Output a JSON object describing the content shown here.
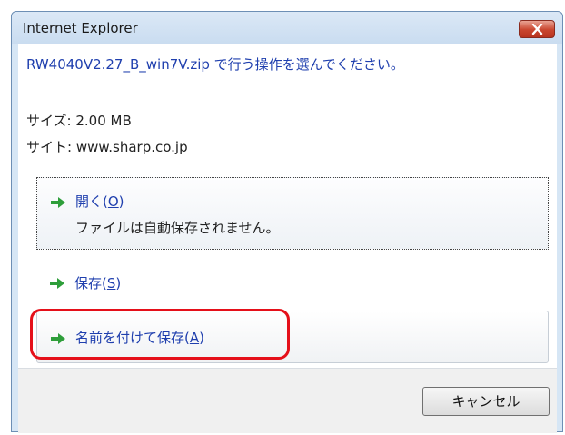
{
  "window": {
    "title": "Internet Explorer"
  },
  "message": {
    "headline": "RW4040V2.27_B_win7V.zip で行う操作を選んでください。",
    "size": "サイズ: 2.00 MB",
    "site": "サイト: www.sharp.co.jp"
  },
  "options": {
    "open": {
      "label": "開く(",
      "accel": "O",
      "close": ")",
      "description": "ファイルは自動保存されません。"
    },
    "save": {
      "label": "保存(",
      "accel": "S",
      "close": ")"
    },
    "save_as": {
      "label": "名前を付けて保存(",
      "accel": "A",
      "close": ")"
    }
  },
  "buttons": {
    "cancel": "キャンセル"
  },
  "colors": {
    "link": "#1f3fae",
    "arrow": "#2e9e3a",
    "highlight": "#e5101a",
    "close": "#c9452e"
  },
  "icons": {
    "close": "close-icon",
    "option": "arrow-right-icon"
  }
}
